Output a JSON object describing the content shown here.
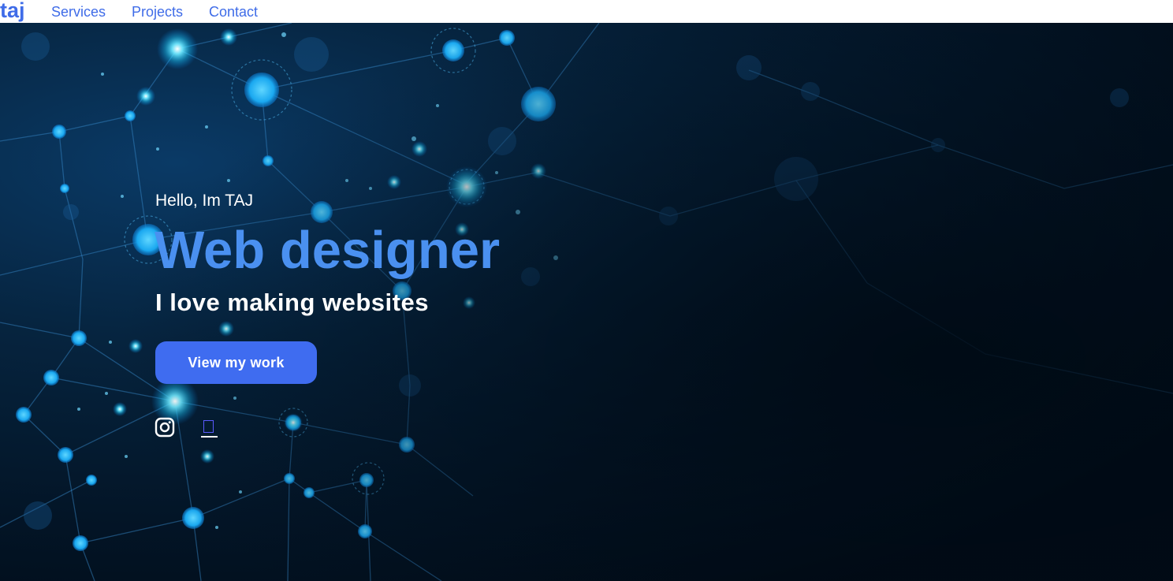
{
  "nav": {
    "logo": "taj",
    "links": [
      "Services",
      "Projects",
      "Contact"
    ]
  },
  "hero": {
    "greeting": "Hello, Im TAJ",
    "title": "Web designer",
    "subtitle": "I love making websites",
    "cta_label": "View my work"
  },
  "social": {
    "icons": [
      "instagram-icon",
      "missing-glyph-icon"
    ]
  },
  "colors": {
    "brand": "#3f6ce8",
    "title": "#4a90f0",
    "button": "#3f6cf0",
    "background": "#031527"
  }
}
